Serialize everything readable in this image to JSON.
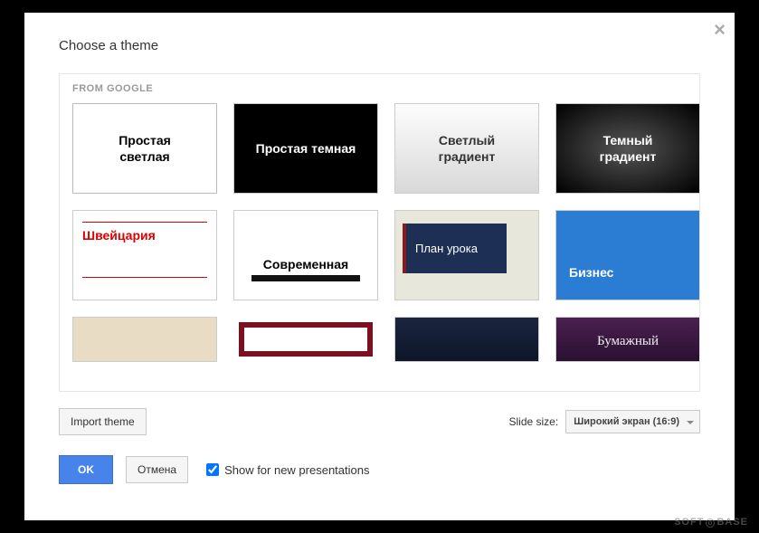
{
  "dialog": {
    "title": "Choose a theme",
    "section_label": "FROM GOOGLE"
  },
  "themes": [
    {
      "id": "simple-light",
      "label": "Простая\nсветлая"
    },
    {
      "id": "simple-dark",
      "label": "Простая темная"
    },
    {
      "id": "light-gradient",
      "label": "Светлый\nградиент"
    },
    {
      "id": "dark-gradient",
      "label": "Темный\nградиент"
    },
    {
      "id": "swiss",
      "label": "Швейцария"
    },
    {
      "id": "modern",
      "label": "Современная"
    },
    {
      "id": "lesson-plan",
      "label": "План урока"
    },
    {
      "id": "business",
      "label": "Бизнес"
    },
    {
      "id": "beige",
      "label": ""
    },
    {
      "id": "maroon-frame",
      "label": ""
    },
    {
      "id": "navy",
      "label": ""
    },
    {
      "id": "paper",
      "label": "Бумажный"
    }
  ],
  "footer": {
    "import_theme": "Import theme",
    "slide_size_label": "Slide size:",
    "slide_size_value": "Широкий экран (16:9)",
    "ok": "OK",
    "cancel": "Отмена",
    "show_new": "Show for new presentations",
    "show_new_checked": true
  },
  "watermark": {
    "left": "SOFT",
    "right": "BASE"
  }
}
